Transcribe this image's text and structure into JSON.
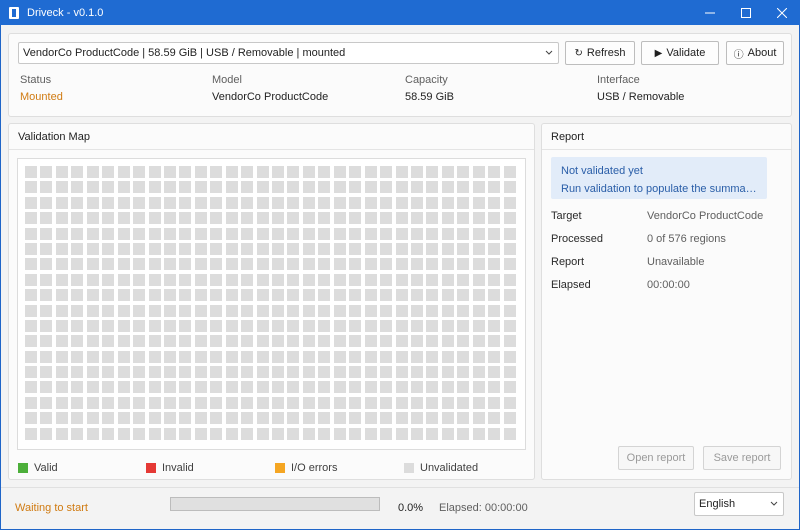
{
  "window": {
    "title": "Driveck - v0.1.0",
    "minimize_icon": "minimize-icon",
    "maximize_icon": "maximize-icon",
    "close_icon": "close-icon"
  },
  "device": {
    "selected": "VendorCo ProductCode | 58.59 GiB | USB / Removable | mounted",
    "refresh_label": "Refresh",
    "validate_label": "Validate",
    "about_label": "About",
    "refresh_icon": "refresh-icon",
    "validate_icon": "play-icon",
    "about_icon": "info-icon",
    "info": [
      {
        "label": "Status",
        "value": "Mounted"
      },
      {
        "label": "Model",
        "value": "VendorCo ProductCode"
      },
      {
        "label": "Capacity",
        "value": "58.59 GiB"
      },
      {
        "label": "Interface",
        "value": "USB / Removable"
      }
    ]
  },
  "validation_map": {
    "title": "Validation Map",
    "regions_total": 576,
    "columns": 32,
    "rows": 18,
    "legend": [
      {
        "label": "Valid",
        "color": "#4caf3a"
      },
      {
        "label": "Invalid",
        "color": "#e53935"
      },
      {
        "label": "I/O errors",
        "color": "#f5a623"
      },
      {
        "label": "Unvalidated",
        "color": "#dcdcdc"
      }
    ]
  },
  "report": {
    "title": "Report",
    "notice_title": "Not validated yet",
    "notice_body": "Run validation to populate the summar...",
    "rows": [
      {
        "key": "Target",
        "value": "VendorCo ProductCode"
      },
      {
        "key": "Processed",
        "value": "0 of 576 regions"
      },
      {
        "key": "Report",
        "value": "Unavailable"
      },
      {
        "key": "Elapsed",
        "value": "00:00:00"
      }
    ],
    "open_label": "Open report",
    "save_label": "Save report"
  },
  "statusbar": {
    "status": "Waiting to start",
    "progress_fraction": 0.0,
    "progress_text": "0.0%",
    "elapsed": "Elapsed: 00:00:00",
    "language": "English"
  },
  "colors": {
    "titlebar": "#1f6bd2",
    "status_warning": "#d07b12",
    "notice_text": "#2a5ea8"
  }
}
